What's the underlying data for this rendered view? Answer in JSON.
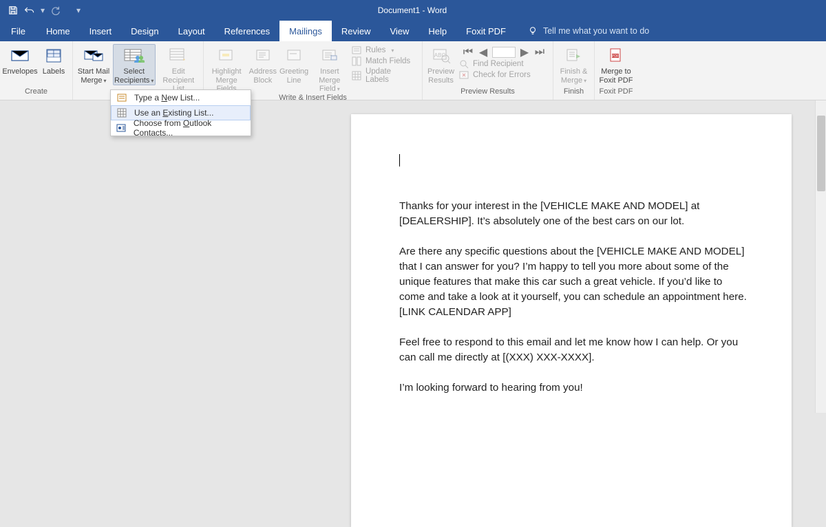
{
  "title": "Document1  -  Word",
  "tabs": {
    "file": "File",
    "home": "Home",
    "insert": "Insert",
    "design": "Design",
    "layout": "Layout",
    "references": "References",
    "mailings": "Mailings",
    "review": "Review",
    "view": "View",
    "help": "Help",
    "foxit": "Foxit PDF",
    "tellme": "Tell me what you want to do"
  },
  "ribbon": {
    "create": {
      "label": "Create",
      "envelopes": "Envelopes",
      "labels": "Labels"
    },
    "startmm": {
      "start": "Start Mail\nMerge",
      "select": "Select\nRecipients",
      "edit": "Edit\nRecipient List"
    },
    "write": {
      "label": "Write & Insert Fields",
      "highlight": "Highlight\nMerge Fields",
      "address": "Address\nBlock",
      "greeting": "Greeting\nLine",
      "insert": "Insert Merge\nField",
      "rules": "Rules",
      "match": "Match Fields",
      "update": "Update Labels"
    },
    "preview": {
      "label": "Preview Results",
      "btn": "Preview\nResults",
      "find": "Find Recipient",
      "check": "Check for Errors"
    },
    "finish": {
      "label": "Finish",
      "btn": "Finish &\nMerge"
    },
    "foxit": {
      "label": "Foxit PDF",
      "btn": "Merge to\nFoxit PDF"
    }
  },
  "menu": {
    "type": "Type a New List...",
    "existing": "Use an Existing List...",
    "outlook": "Choose from Outlook Contacts..."
  },
  "doc": {
    "p1": "Thanks for your interest in the [VEHICLE MAKE AND MODEL] at [DEALERSHIP]. It’s absolutely one of the best cars on our lot.",
    "p2": "Are there any specific questions about the [VEHICLE MAKE AND MODEL] that I can answer for you? I’m happy to tell you more about some of the unique features that make this car such a great vehicle. If you’d like to come and take a look at it yourself, you can schedule an appointment here. [LINK CALENDAR APP]",
    "p3": "Feel free to respond to this email and let me know how I can help. Or you can call me directly at [(XXX) XXX-XXXX].",
    "p4": "I’m looking forward to hearing from you!"
  }
}
